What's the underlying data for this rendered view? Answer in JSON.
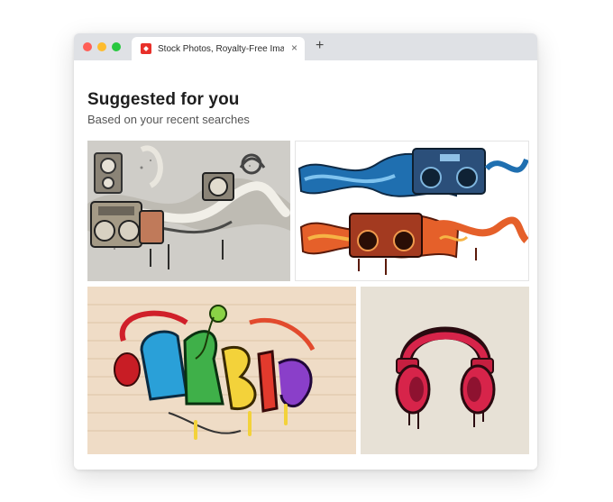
{
  "browser": {
    "tab_title": "Stock Photos, Royalty-Free Ima",
    "tab_close": "×",
    "new_tab": "+"
  },
  "page": {
    "heading": "Suggested for you",
    "subheading": "Based on your recent searches"
  },
  "images": [
    {
      "id": "boombox-graffiti-beige"
    },
    {
      "id": "boombox-graffiti-blue-orange"
    },
    {
      "id": "music-graffiti-brick-wall"
    },
    {
      "id": "red-headphones-drip"
    }
  ],
  "colors": {
    "accent": "#e8302a",
    "titlebar": "#dfe1e5"
  }
}
